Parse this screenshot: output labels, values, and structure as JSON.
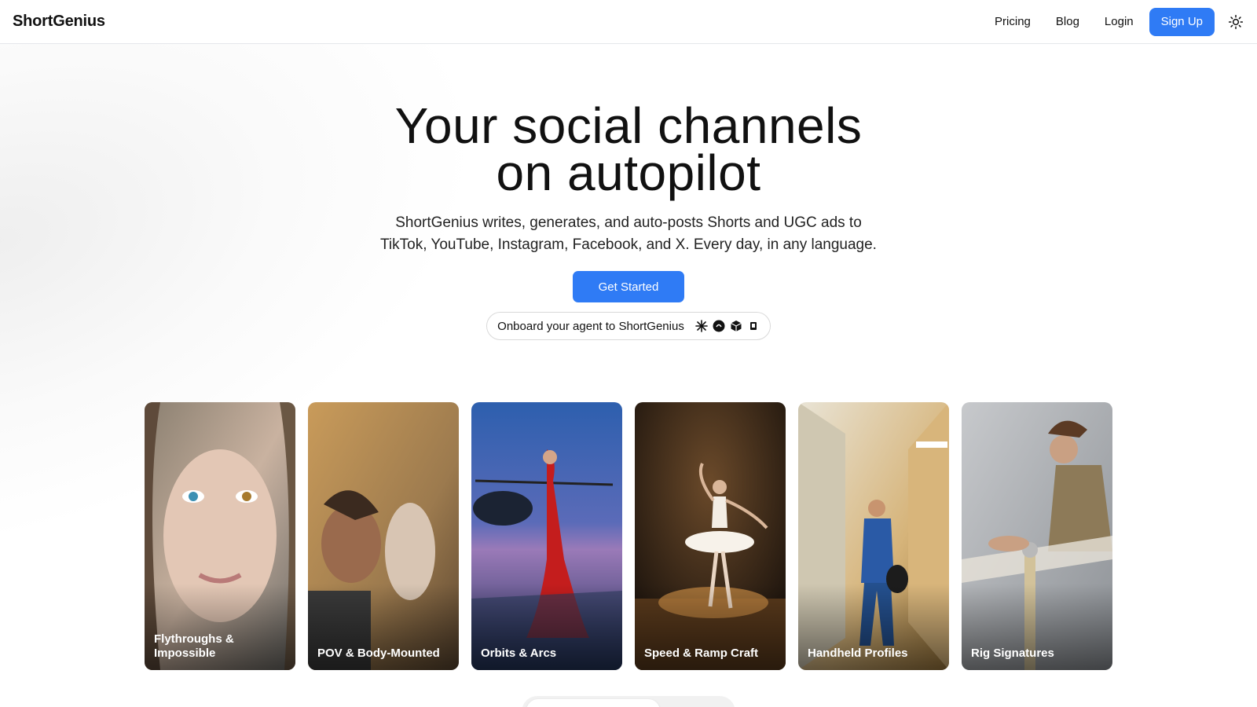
{
  "header": {
    "logo": "ShortGenius",
    "nav": [
      "Pricing",
      "Blog",
      "Login"
    ],
    "signup_label": "Sign Up",
    "theme_icon": "sun-icon"
  },
  "hero": {
    "title_line1": "Your social channels",
    "title_line2": "on autopilot",
    "subtitle_line1": "ShortGenius writes, generates, and auto-posts Shorts and UGC ads to",
    "subtitle_line2": "TikTok, YouTube, Instagram, Facebook, and X. Every day, in any language.",
    "cta_label": "Get Started",
    "agent_label": "Onboard your agent to ShortGenius",
    "agent_icons": [
      "sparkle-icon",
      "chat-icon",
      "cube-icon",
      "robot-icon"
    ]
  },
  "cards": [
    {
      "label": "Flythroughs & Impossible"
    },
    {
      "label": "POV & Body-Mounted"
    },
    {
      "label": "Orbits & Arcs"
    },
    {
      "label": "Speed & Ramp Craft"
    },
    {
      "label": "Handheld Profiles"
    },
    {
      "label": "Rig Signatures"
    }
  ],
  "colors": {
    "accent": "#2f7bf5",
    "text": "#111111",
    "border": "#e5e7eb"
  }
}
